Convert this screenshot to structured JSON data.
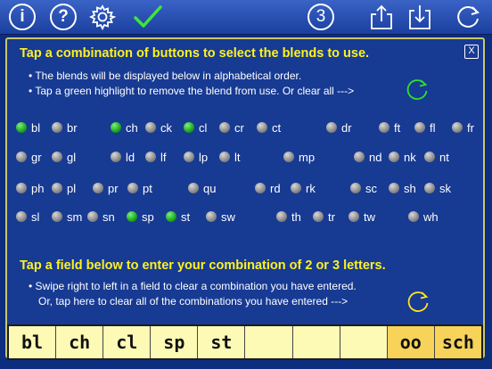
{
  "toolbar": {
    "info_label": "i",
    "help_label": "?",
    "count_label": "3"
  },
  "instructions": {
    "select_heading": "Tap a combination of buttons to select the blends to use.",
    "note1": "• The blends will be displayed below in alphabetical order.",
    "note2": "• Tap a green highlight to remove the blend from use. Or clear all  --->",
    "enter_heading": "Tap a field below to enter your combination of 2 or 3 letters.",
    "note3": "• Swipe right to left in a field to clear a combination you have entered.",
    "note4": "Or, tap here to clear all of the combinations you have entered  --->",
    "close_label": "X"
  },
  "blends": [
    {
      "label": "bl",
      "on": true
    },
    {
      "label": "br",
      "on": false
    },
    {
      "label": "ch",
      "on": true
    },
    {
      "label": "ck",
      "on": false
    },
    {
      "label": "cl",
      "on": true
    },
    {
      "label": "cr",
      "on": false
    },
    {
      "label": "ct",
      "on": false
    },
    {
      "label": "dr",
      "on": false
    },
    {
      "label": "ft",
      "on": false
    },
    {
      "label": "fl",
      "on": false
    },
    {
      "label": "fr",
      "on": false
    },
    {
      "label": "gr",
      "on": false
    },
    {
      "label": "gl",
      "on": false
    },
    {
      "label": "ld",
      "on": false
    },
    {
      "label": "lf",
      "on": false
    },
    {
      "label": "lp",
      "on": false
    },
    {
      "label": "lt",
      "on": false
    },
    {
      "label": "mp",
      "on": false
    },
    {
      "label": "nd",
      "on": false
    },
    {
      "label": "nk",
      "on": false
    },
    {
      "label": "nt",
      "on": false
    },
    {
      "label": "ph",
      "on": false
    },
    {
      "label": "pl",
      "on": false
    },
    {
      "label": "pr",
      "on": false
    },
    {
      "label": "pt",
      "on": false
    },
    {
      "label": "qu",
      "on": false
    },
    {
      "label": "rd",
      "on": false
    },
    {
      "label": "rk",
      "on": false
    },
    {
      "label": "sc",
      "on": false
    },
    {
      "label": "sh",
      "on": false
    },
    {
      "label": "sk",
      "on": false
    },
    {
      "label": "sl",
      "on": false
    },
    {
      "label": "sm",
      "on": false
    },
    {
      "label": "sn",
      "on": false
    },
    {
      "label": "sp",
      "on": true
    },
    {
      "label": "st",
      "on": true
    },
    {
      "label": "sw",
      "on": false
    },
    {
      "label": "th",
      "on": false
    },
    {
      "label": "tr",
      "on": false
    },
    {
      "label": "tw",
      "on": false
    },
    {
      "label": "wh",
      "on": false
    }
  ],
  "fields": [
    {
      "value": "bl",
      "color": "#fdfab6"
    },
    {
      "value": "ch",
      "color": "#fdfab6"
    },
    {
      "value": "cl",
      "color": "#fdfab6"
    },
    {
      "value": "sp",
      "color": "#fdfab6"
    },
    {
      "value": "st",
      "color": "#fdfab6"
    },
    {
      "value": "",
      "color": "#fdfab6"
    },
    {
      "value": "",
      "color": "#fdfab6"
    },
    {
      "value": "",
      "color": "#fdfab6"
    },
    {
      "value": "oo",
      "color": "#f7d35a"
    },
    {
      "value": "sch",
      "color": "#f7d35a"
    }
  ],
  "colors": {
    "background": "#0d2d7e",
    "heading": "#fff21f",
    "selected_dot": "#1ea81f",
    "checkmark": "#3ee63b"
  }
}
